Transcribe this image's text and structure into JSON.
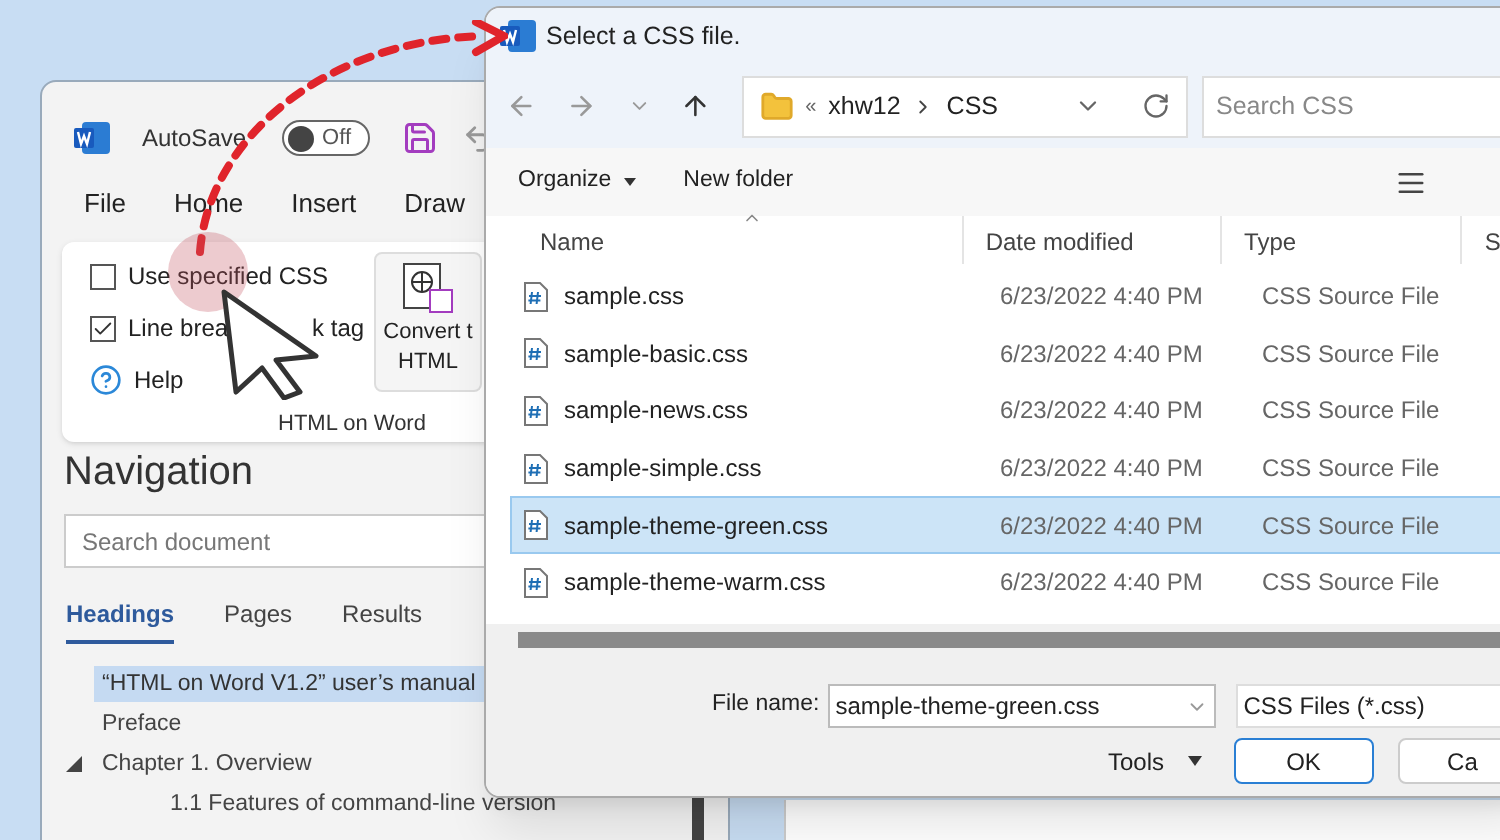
{
  "word_window": {
    "autosave": {
      "label": "AutoSave",
      "toggle_label": "Off",
      "on": false
    },
    "menu": [
      "File",
      "Home",
      "Insert",
      "Draw"
    ],
    "ribbon": {
      "options": [
        {
          "kind": "checkbox",
          "label_parts": [
            "Use specified CSS"
          ],
          "checked": false
        },
        {
          "kind": "checkbox",
          "label_parts": [
            "Line brea",
            "k tag"
          ],
          "checked": true
        },
        {
          "kind": "help",
          "label_parts": [
            "Help"
          ]
        }
      ],
      "convert_button": {
        "label_lines": [
          "Convert t",
          "HTML"
        ]
      },
      "group_label": "HTML on Word"
    },
    "navigation": {
      "title": "Navigation",
      "search": {
        "placeholder": "Search document"
      },
      "tabs": [
        {
          "label": "Headings",
          "selected": true
        },
        {
          "label": "Pages",
          "selected": false
        },
        {
          "label": "Results",
          "selected": false
        }
      ],
      "tree": [
        {
          "label": "“HTML on Word V1.2” user’s manual",
          "selected": true
        },
        {
          "label": "Preface",
          "selected": false
        },
        {
          "label": "Chapter 1. Overview",
          "selected": false,
          "expanded": true,
          "children": [
            {
              "label": "1.1 Features of command-line version",
              "selected": false
            }
          ]
        }
      ]
    }
  },
  "dialog": {
    "title": "Select a CSS file.",
    "address": {
      "overflow_mark": "«",
      "path": [
        "xhw12",
        "CSS"
      ]
    },
    "search": {
      "placeholder": "Search CSS"
    },
    "toolbar": {
      "organize": "Organize",
      "new_folder": "New folder"
    },
    "columns": [
      "Name",
      "Date modified",
      "Type",
      "S"
    ],
    "rows": [
      {
        "name": "sample.css",
        "date": "6/23/2022 4:40 PM",
        "type": "CSS Source File",
        "selected": false
      },
      {
        "name": "sample-basic.css",
        "date": "6/23/2022 4:40 PM",
        "type": "CSS Source File",
        "selected": false
      },
      {
        "name": "sample-news.css",
        "date": "6/23/2022 4:40 PM",
        "type": "CSS Source File",
        "selected": false
      },
      {
        "name": "sample-simple.css",
        "date": "6/23/2022 4:40 PM",
        "type": "CSS Source File",
        "selected": false
      },
      {
        "name": "sample-theme-green.css",
        "date": "6/23/2022 4:40 PM",
        "type": "CSS Source File",
        "selected": true
      },
      {
        "name": "sample-theme-warm.css",
        "date": "6/23/2022 4:40 PM",
        "type": "CSS Source File",
        "selected": false
      }
    ],
    "file_name": {
      "label": "File name:",
      "value": "sample-theme-green.css"
    },
    "filter": "CSS Files (*.css)",
    "tools": "Tools",
    "ok": "OK",
    "cancel": "Ca"
  }
}
